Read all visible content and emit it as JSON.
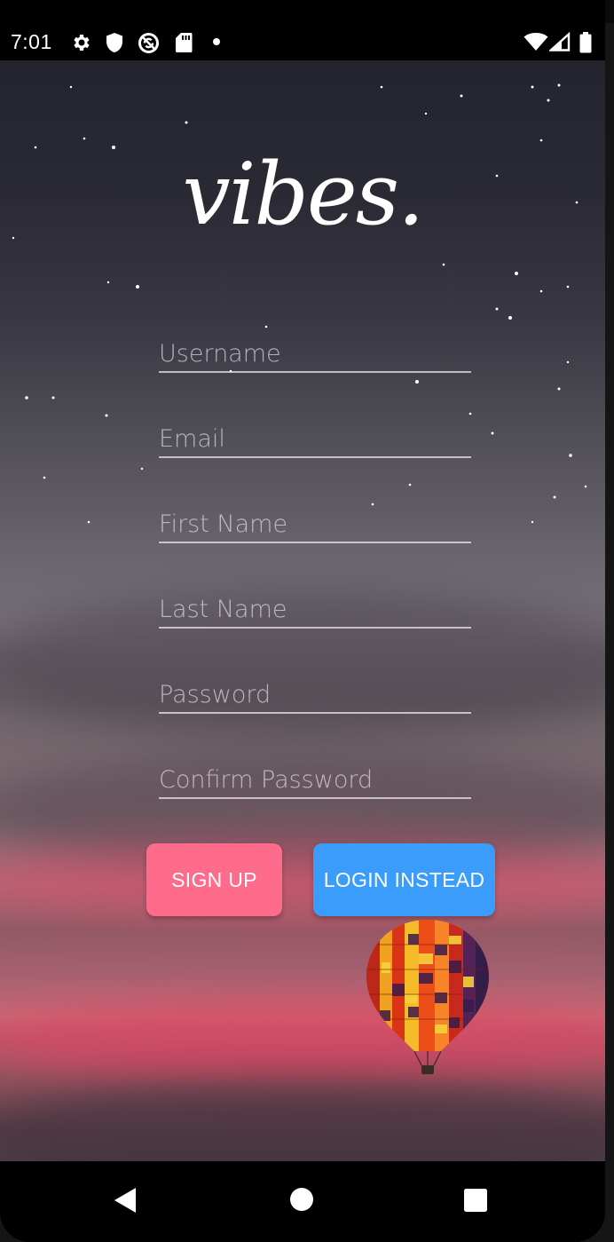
{
  "status_bar": {
    "time": "7:01",
    "left_icons": [
      "gear-icon",
      "shield-icon",
      "no-sync-icon",
      "sd-card-icon",
      "dot-icon"
    ],
    "right_icons": [
      "wifi-icon",
      "signal-icon",
      "battery-icon"
    ]
  },
  "app": {
    "logo": "vibes."
  },
  "form": {
    "fields": [
      {
        "name": "username",
        "placeholder": "Username",
        "value": ""
      },
      {
        "name": "email",
        "placeholder": "Email",
        "value": ""
      },
      {
        "name": "first_name",
        "placeholder": "First Name",
        "value": ""
      },
      {
        "name": "last_name",
        "placeholder": "Last Name",
        "value": ""
      },
      {
        "name": "password",
        "placeholder": "Password",
        "value": ""
      },
      {
        "name": "confirm_password",
        "placeholder": "Confirm Password",
        "value": ""
      }
    ],
    "signup_label": "SIGN UP",
    "login_label": "LOGIN INSTEAD"
  },
  "colors": {
    "signup_button": "#fe6b8b",
    "login_button": "#3a9cfb",
    "field_underline": "#e6e1e6"
  },
  "nav_bar": {
    "buttons": [
      "back-icon",
      "home-icon",
      "recents-icon"
    ]
  }
}
